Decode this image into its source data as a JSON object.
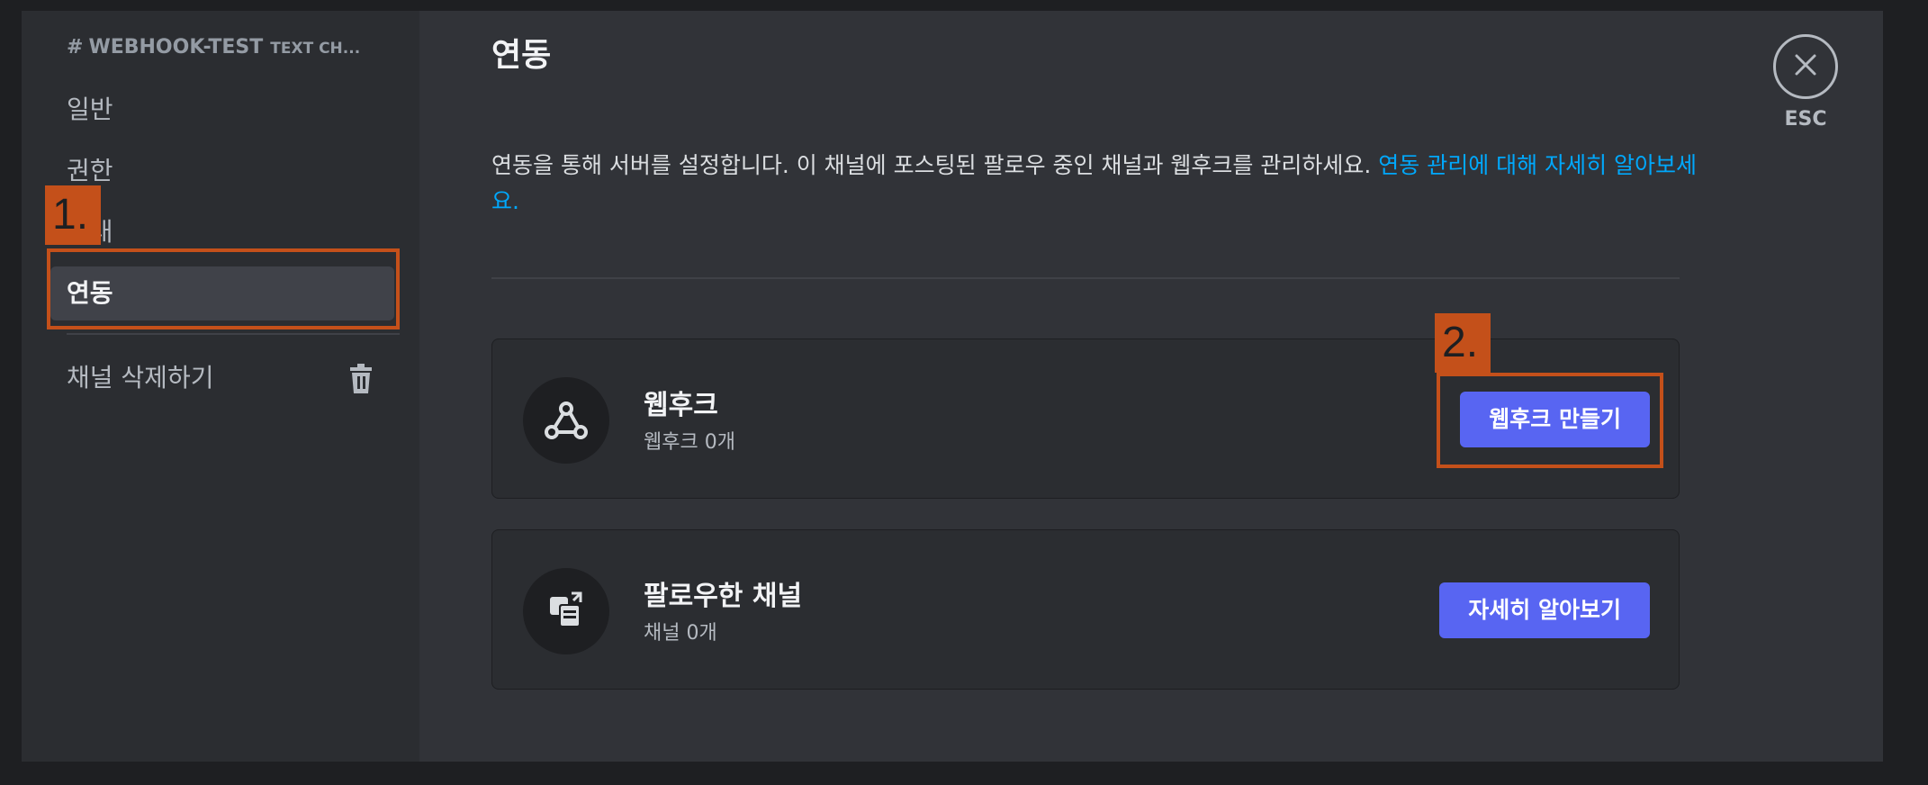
{
  "sidebar": {
    "channel": {
      "hash": "#",
      "name": "WEBHOOK-TEST",
      "subtitle": "TEXT CH..."
    },
    "items": [
      {
        "label": "일반"
      },
      {
        "label": "권한"
      },
      {
        "label": "초대"
      },
      {
        "label": "연동"
      }
    ],
    "delete_label": "채널 삭제하기"
  },
  "main": {
    "title": "연동",
    "description": "연동을 통해 서버를 설정합니다. 이 채널에 포스팅된 팔로우 중인 채널과 웹후크를 관리하세요. ",
    "description_link": "연동 관리에 대해 자세히 알아보세요.",
    "cards": [
      {
        "title": "웹후크",
        "subtitle": "웹후크 0개",
        "button": "웹후크 만들기",
        "icon": "webhook-icon"
      },
      {
        "title": "팔로우한 채널",
        "subtitle": "채널 0개",
        "button": "자세히 알아보기",
        "icon": "followed-channel-icon"
      }
    ]
  },
  "close": {
    "label": "ESC",
    "icon": "close-icon"
  },
  "annotations": [
    {
      "label": "1."
    },
    {
      "label": "2."
    }
  ],
  "colors": {
    "accent": "#5865f2",
    "link": "#00a8fc",
    "annotation": "#c4501a"
  }
}
